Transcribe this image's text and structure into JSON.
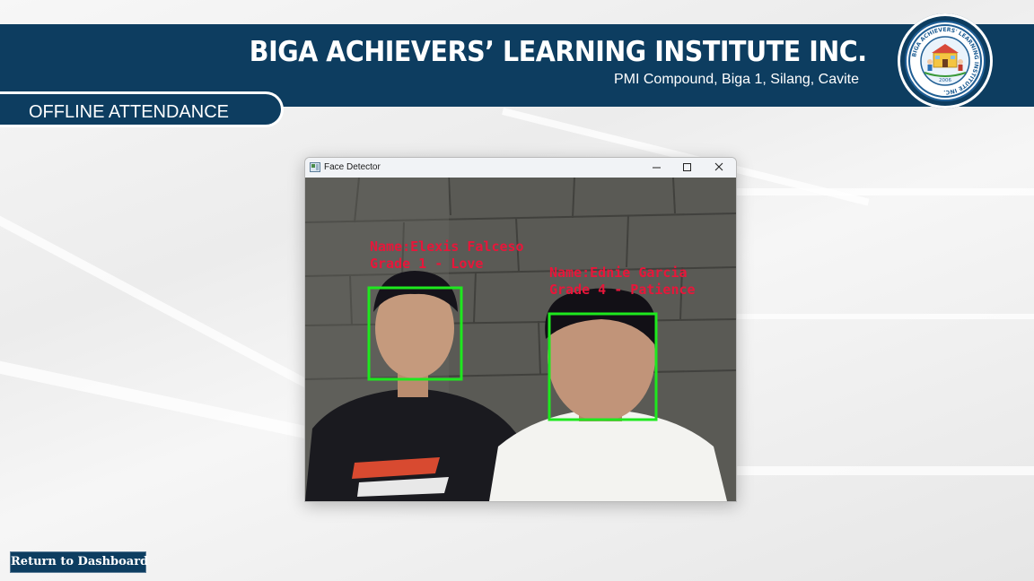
{
  "header": {
    "institution_name": "BIGA ACHIEVERS’ LEARNING INSTITUTE INC.",
    "address": "PMI Compound, Biga 1, Silang, Cavite",
    "logo": {
      "ring_text": "BIGA ACHIEVERS' LEARNING INSTITUTE INC.",
      "year": "2006"
    }
  },
  "page": {
    "section_title": "OFFLINE ATTENDANCE"
  },
  "face_window": {
    "title": "Face Detector",
    "controls": [
      "minimize-icon",
      "maximize-icon",
      "close-icon"
    ],
    "detections": [
      {
        "name_label": "Name:Elexis Falceso",
        "grade_label": "Grade 1 - Love"
      },
      {
        "name_label": "Name:Ednie Garcia",
        "grade_label": "Grade 4 - Patience"
      }
    ],
    "box_color": "#1ee81e",
    "label_color": "#e8163a"
  },
  "footer": {
    "return_label": "Return to Dashboard"
  },
  "colors": {
    "brand_navy": "#0d3d60"
  }
}
